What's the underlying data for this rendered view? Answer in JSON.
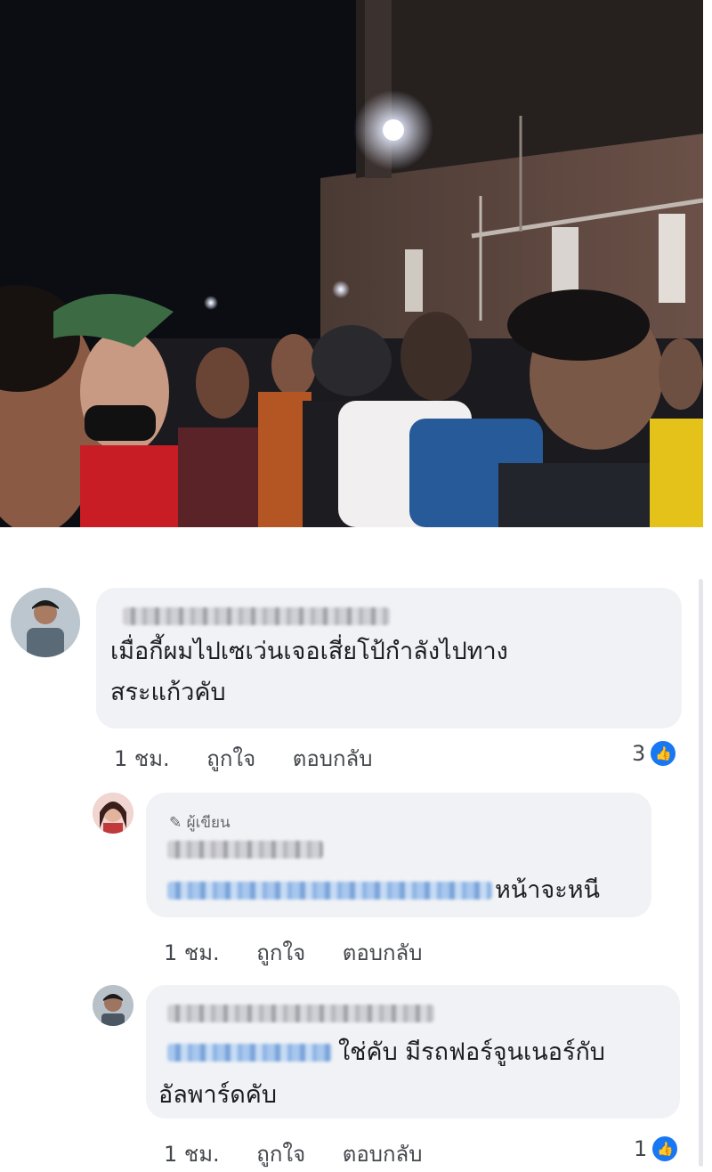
{
  "photo": {
    "alt": ""
  },
  "comments": [
    {
      "text_line1": "เมื่อกี้ผมไปเซเว่นเจอเสี่ยโป้กำลังไปทาง",
      "text_line2": "สระแก้วคับ",
      "time": "1 ชม.",
      "like_label": "ถูกใจ",
      "reply_label": "ตอบกลับ",
      "reaction_count": "3",
      "replies": [
        {
          "author_tag": "ผู้เขียน",
          "text": "หน้าจะหนี",
          "time": "1 ชม.",
          "like_label": "ถูกใจ",
          "reply_label": "ตอบกลับ"
        },
        {
          "text_line1": "ใช่คับ มีรถฟอร์จูนเนอร์กับ",
          "text_line2": "อัลพาร์ดคับ",
          "time": "1 ชม.",
          "like_label": "ถูกใจ",
          "reply_label": "ตอบกลับ",
          "reaction_count": "1"
        }
      ]
    }
  ],
  "colors": {
    "bubble": "#f0f2f5",
    "like_blue": "#1877f2",
    "text": "#1c1e21",
    "meta": "#44474d"
  },
  "icons": [
    "pencil-icon",
    "thumbs-up-icon"
  ]
}
